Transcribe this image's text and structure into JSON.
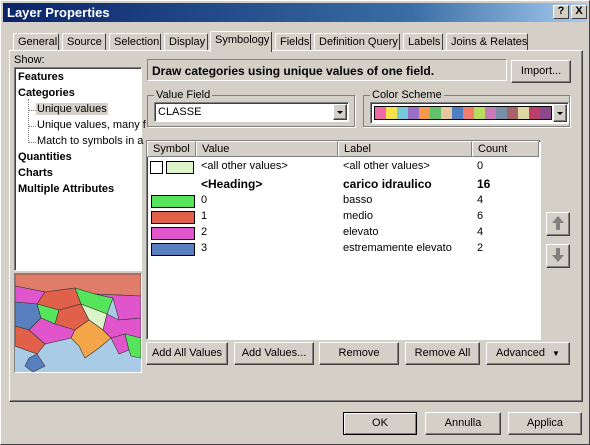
{
  "window": {
    "title": "Layer Properties"
  },
  "title_buttons": {
    "help": "?",
    "close": "X"
  },
  "tabs": [
    "General",
    "Source",
    "Selection",
    "Display",
    "Symbology",
    "Fields",
    "Definition Query",
    "Labels",
    "Joins & Relates"
  ],
  "active_tab": "Symbology",
  "show": {
    "label": "Show:",
    "items": [
      {
        "label": "Features",
        "bold": true
      },
      {
        "label": "Categories",
        "bold": true
      },
      {
        "label": "Unique values",
        "selected": true
      },
      {
        "label": "Unique values, many f"
      },
      {
        "label": "Match to symbols in a"
      },
      {
        "label": "Quantities",
        "bold": true
      },
      {
        "label": "Charts",
        "bold": true
      },
      {
        "label": "Multiple Attributes",
        "bold": true
      }
    ]
  },
  "description": "Draw categories using unique values of one field.",
  "import_button": "Import...",
  "value_field": {
    "label": "Value Field",
    "value": "CLASSE"
  },
  "color_scheme": {
    "label": "Color Scheme",
    "colors": [
      "#f06aa8",
      "#f5e24c",
      "#73c9d6",
      "#9a6fc6",
      "#f59a4a",
      "#5fc16a",
      "#e8c6a0",
      "#4f7fc2",
      "#f27d6f",
      "#b8dc5e",
      "#c77bb8",
      "#7a8fa6",
      "#a8626a",
      "#d9d9a0",
      "#bb3f6a",
      "#8a4a8a"
    ]
  },
  "table": {
    "headers": [
      "Symbol",
      "Value",
      "Label",
      "Count"
    ],
    "rows": [
      {
        "color": "#dcf5c8",
        "value": "<all other values>",
        "label": "<all other values>",
        "count": "0",
        "checkbox": true
      },
      {
        "color": "",
        "value": "<Heading>",
        "label": "carico idraulico",
        "count": "16",
        "bold": true
      },
      {
        "color": "#55e45a",
        "value": "0",
        "label": "basso",
        "count": "4"
      },
      {
        "color": "#e0604a",
        "value": "1",
        "label": "medio",
        "count": "6"
      },
      {
        "color": "#e055cc",
        "value": "2",
        "label": "elevato",
        "count": "4"
      },
      {
        "color": "#5a7fbf",
        "value": "3",
        "label": "estremamente elevato",
        "count": "2"
      }
    ]
  },
  "move_buttons": {
    "up": "move-up",
    "down": "move-down"
  },
  "actions": {
    "add_all": "Add All Values",
    "add_values": "Add Values...",
    "remove": "Remove",
    "remove_all": "Remove All",
    "advanced": "Advanced"
  },
  "footer": {
    "ok": "OK",
    "cancel": "Annulla",
    "apply": "Applica"
  }
}
